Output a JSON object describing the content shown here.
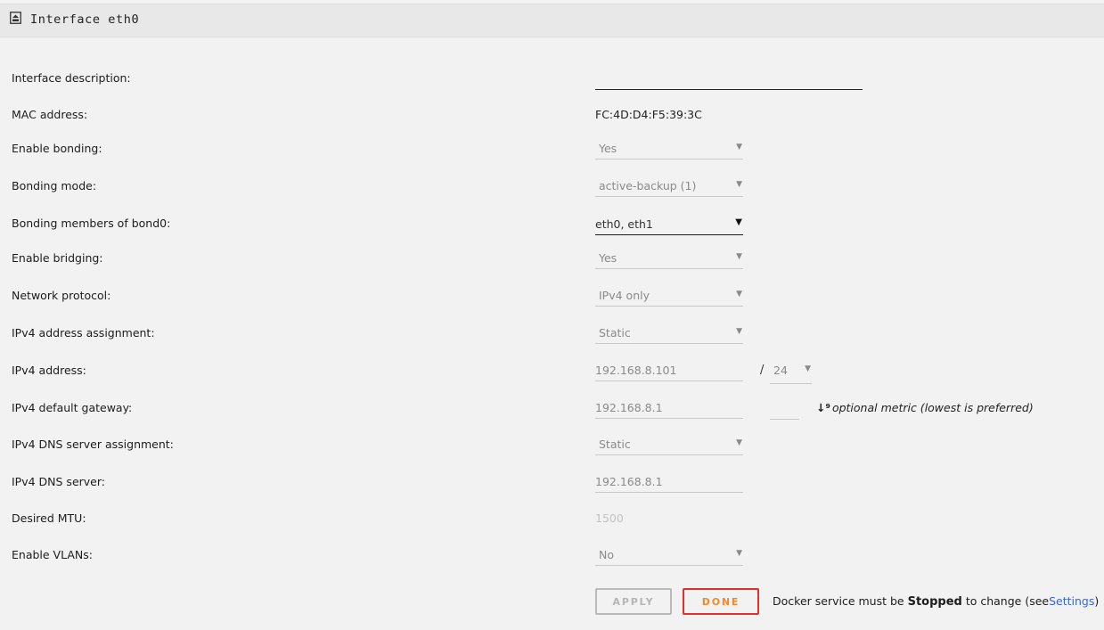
{
  "header": {
    "title": "Interface eth0",
    "icon": "network-interface-icon"
  },
  "fields": {
    "interface_description": {
      "label": "Interface description:",
      "value": ""
    },
    "mac_address": {
      "label": "MAC address:",
      "value": "FC:4D:D4:F5:39:3C"
    },
    "enable_bonding": {
      "label": "Enable bonding:",
      "value": "Yes"
    },
    "bonding_mode": {
      "label": "Bonding mode:",
      "value": "active-backup (1)"
    },
    "bonding_members": {
      "label": "Bonding members of bond0:",
      "value": "eth0, eth1"
    },
    "enable_bridging": {
      "label": "Enable bridging:",
      "value": "Yes"
    },
    "network_protocol": {
      "label": "Network protocol:",
      "value": "IPv4 only"
    },
    "ipv4_assignment": {
      "label": "IPv4 address assignment:",
      "value": "Static"
    },
    "ipv4_address": {
      "label": "IPv4 address:",
      "value": "192.168.8.101",
      "separator": "/",
      "prefix": "24"
    },
    "ipv4_gateway": {
      "label": "IPv4 default gateway:",
      "value": "192.168.8.1",
      "metric_value": "",
      "metric_hint": "optional metric (lowest is preferred)",
      "metric_icon": "sort-numeric-icon"
    },
    "ipv4_dns_assignment": {
      "label": "IPv4 DNS server assignment:",
      "value": "Static"
    },
    "ipv4_dns_server": {
      "label": "IPv4 DNS server:",
      "value": "192.168.8.1"
    },
    "desired_mtu": {
      "label": "Desired MTU:",
      "placeholder": "1500"
    },
    "enable_vlans": {
      "label": "Enable VLANs:",
      "value": "No"
    }
  },
  "buttons": {
    "apply": "APPLY",
    "done": "DONE"
  },
  "docker_note": {
    "prefix": "Docker service must be",
    "status": "Stopped",
    "middle": "to change (see",
    "link": "Settings",
    "suffix": ")"
  },
  "colors": {
    "accent_done_border": "#e2302a",
    "accent_done_text": "#f08a2c",
    "link": "#3b68c2"
  }
}
